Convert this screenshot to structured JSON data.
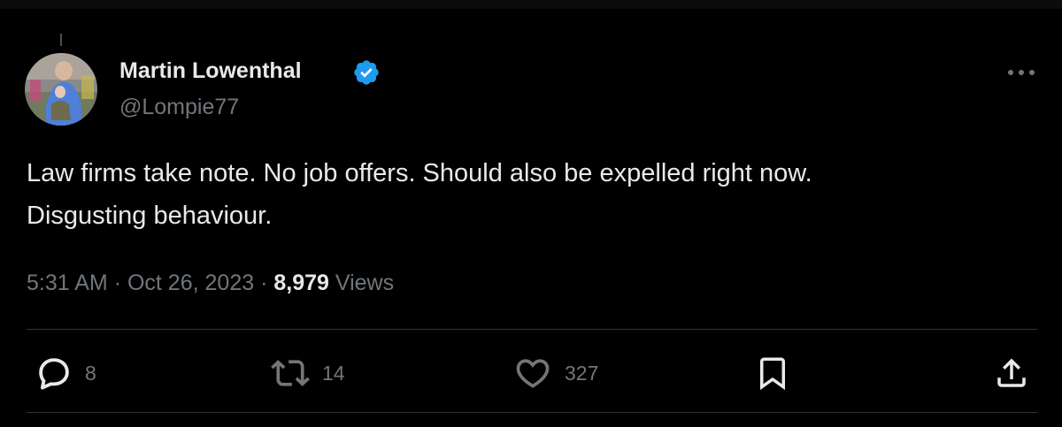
{
  "user": {
    "display_name": "Martin Lowenthal",
    "handle": "@Lompie77",
    "verified": true
  },
  "tweet": {
    "text_line1": "Law firms take note. No job offers. Should also be expelled right now.",
    "text_line2": "Disgusting behaviour.",
    "time": "5:31 AM",
    "separator": "·",
    "date": "Oct 26, 2023",
    "views_count": "8,979",
    "views_label": "Views"
  },
  "actions": {
    "replies": "8",
    "retweets": "14",
    "likes": "327"
  },
  "icons": {
    "verified": "verified-badge-icon",
    "more": "more-options-icon",
    "reply": "reply-icon",
    "retweet": "retweet-icon",
    "like": "heart-icon",
    "bookmark": "bookmark-icon",
    "share": "share-icon"
  },
  "colors": {
    "background": "#000000",
    "text_primary": "#e7e9ea",
    "text_secondary": "#71767b",
    "verified_blue": "#1d9bf0",
    "divider": "#2f3336"
  }
}
